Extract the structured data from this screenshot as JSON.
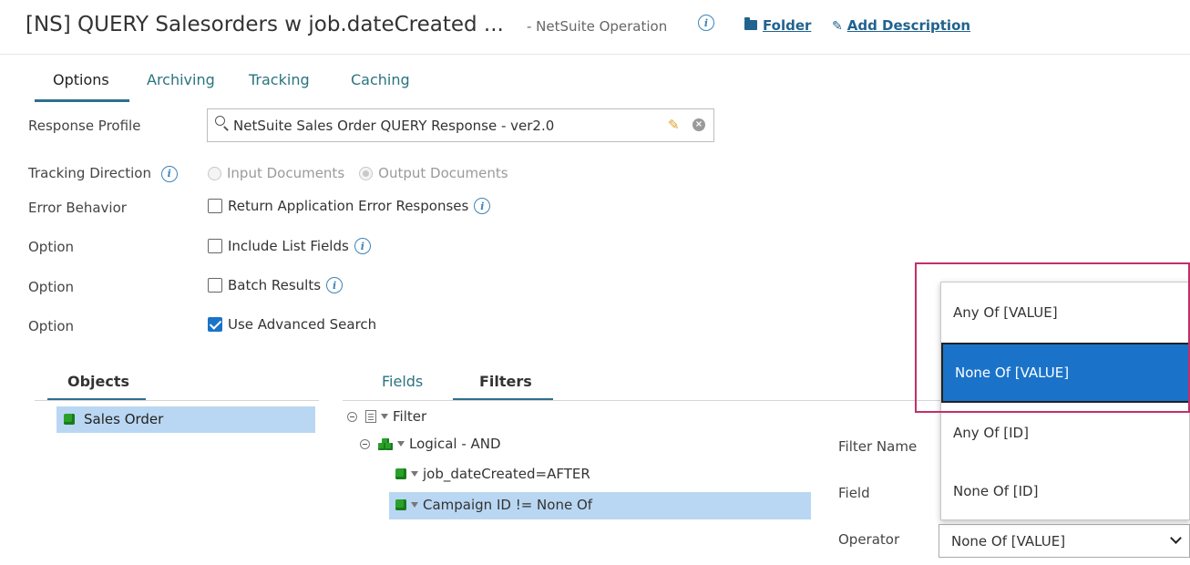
{
  "header": {
    "title": "[NS] QUERY Salesorders w job.dateCreated ...",
    "subtitle": "- NetSuite Operation",
    "folder_label": "Folder",
    "add_description_label": "Add Description"
  },
  "tabs": [
    {
      "label": "Options",
      "active": true
    },
    {
      "label": "Archiving",
      "active": false
    },
    {
      "label": "Tracking",
      "active": false
    },
    {
      "label": "Caching",
      "active": false
    }
  ],
  "form": {
    "response_profile": {
      "label": "Response Profile",
      "value": "NetSuite Sales Order QUERY Response - ver2.0"
    },
    "tracking_direction": {
      "label": "Tracking Direction",
      "options": [
        "Input Documents",
        "Output Documents"
      ],
      "selected": "Output Documents"
    },
    "error_behavior": {
      "label": "Error Behavior",
      "checkbox_label": "Return Application Error Responses",
      "checked": false
    },
    "options": [
      {
        "label": "Option",
        "checkbox_label": "Include List Fields",
        "checked": false,
        "has_info": true
      },
      {
        "label": "Option",
        "checkbox_label": "Batch Results",
        "checked": false,
        "has_info": true
      },
      {
        "label": "Option",
        "checkbox_label": "Use Advanced Search",
        "checked": true,
        "has_info": false
      }
    ]
  },
  "objects_panel": {
    "tab_label": "Objects",
    "items": [
      "Sales Order"
    ]
  },
  "filters_panel": {
    "tabs": [
      {
        "label": "Fields",
        "active": false
      },
      {
        "label": "Filters",
        "active": true
      }
    ],
    "tree": {
      "root": "Filter",
      "logical": "Logical - AND",
      "children": [
        "job_dateCreated=AFTER",
        "Campaign ID != None Of"
      ]
    }
  },
  "detail_panel": {
    "filter_name_label": "Filter Name",
    "field_label": "Field",
    "operator_label": "Operator",
    "operator_value": "None Of [VALUE]"
  },
  "operator_dropdown": {
    "options": [
      "Any Of [VALUE]",
      "None Of [VALUE]",
      "Any Of [ID]",
      "None Of [ID]"
    ],
    "selected": "None Of [VALUE]",
    "accent_color": "#1a73c9",
    "highlight_color": "#c0306a"
  }
}
